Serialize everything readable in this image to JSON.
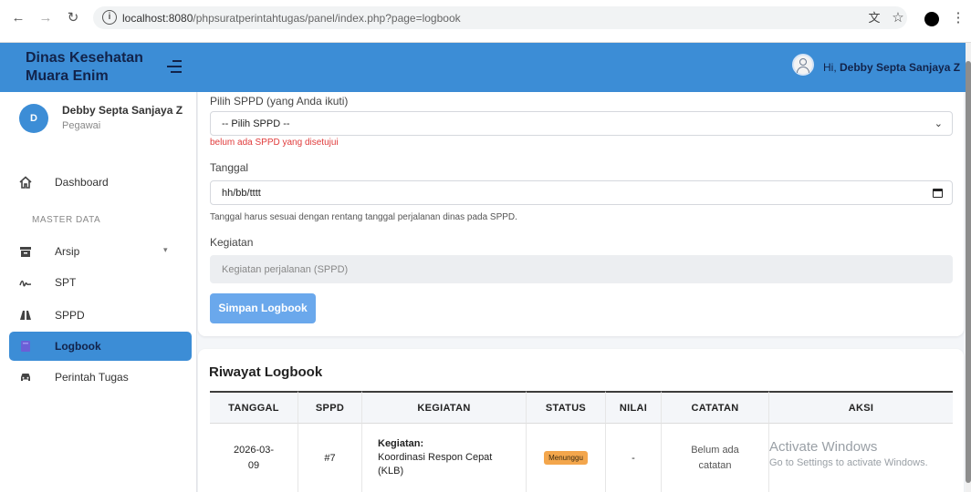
{
  "browser": {
    "url_host": "localhost:8080",
    "url_path": "/phpsuratperintahtugas/panel/index.php?page=logbook"
  },
  "sidebar": {
    "app_title": "Dinas Kesehatan Muara Enim",
    "user": {
      "initial": "D",
      "name": "Debby Septa Sanjaya Z",
      "role": "Pegawai"
    },
    "section_label": "MASTER DATA",
    "items": [
      {
        "label": "Dashboard",
        "icon": "home-icon"
      },
      {
        "label": "Arsip",
        "icon": "archive-icon"
      },
      {
        "label": "SPT",
        "icon": "signature-icon"
      },
      {
        "label": "SPPD",
        "icon": "road-icon"
      },
      {
        "label": "Logbook",
        "icon": "book-icon",
        "active": true
      },
      {
        "label": "Perintah Tugas",
        "icon": "car-icon"
      }
    ]
  },
  "topbar": {
    "greeting_prefix": "Hi,",
    "user_name": "Debby Septa Sanjaya Z"
  },
  "form": {
    "sppd_label": "Pilih SPPD (yang Anda ikuti)",
    "sppd_value": "-- Pilih SPPD --",
    "sppd_error": "belum ada SPPD yang disetujui",
    "date_label": "Tanggal",
    "date_value": "hh/bb/tttt",
    "date_help": "Tanggal harus sesuai dengan rentang tanggal perjalanan dinas pada SPPD.",
    "activity_label": "Kegiatan",
    "activity_placeholder": "Kegiatan perjalanan (SPPD)",
    "submit_label": "Simpan Logbook"
  },
  "history": {
    "title": "Riwayat Logbook",
    "columns": [
      "TANGGAL",
      "SPPD",
      "KEGIATAN",
      "STATUS",
      "NILAI",
      "CATATAN",
      "AKSI"
    ],
    "rows": [
      {
        "tanggal": "2026-03-09",
        "sppd": "#7",
        "kegiatan_label": "Kegiatan:",
        "kegiatan": "Koordinasi Respon Cepat (KLB)",
        "status": "Menunggu",
        "nilai": "-",
        "catatan": "Belum ada catatan",
        "aksi": ""
      }
    ]
  },
  "watermark": {
    "title": "Activate Windows",
    "subtitle": "Go to Settings to activate Windows."
  },
  "colors": {
    "primary": "#3c8dd6",
    "button": "#6aa8ec",
    "error": "#e03b3b",
    "badge_waiting": "#f3a64c"
  }
}
